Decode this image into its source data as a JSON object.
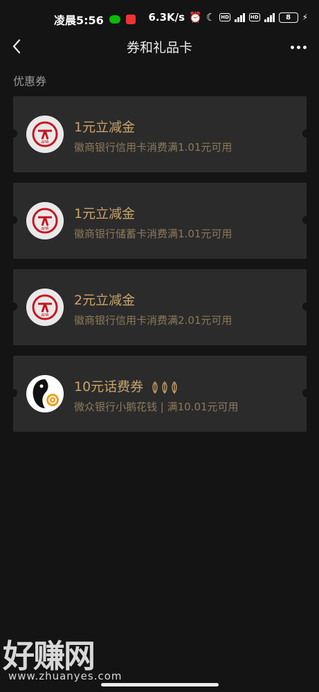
{
  "status_bar": {
    "time": "凌晨5:56",
    "speed": "6.3K/s",
    "hd1": "HD",
    "net1": "4G",
    "hd2": "HD",
    "net2": "5G",
    "battery": "8"
  },
  "nav": {
    "title": "券和礼品卡",
    "back_icon": "chevron-left-icon",
    "more_icon": "more-dots-icon"
  },
  "section_label": "优惠券",
  "coupons": [
    {
      "title": "1元立减金",
      "desc": "徽商银行信用卡消费满1.01元可用",
      "logo": "huishang-bank-logo"
    },
    {
      "title": "1元立减金",
      "desc": "徽商银行储蓄卡消费满1.01元可用",
      "logo": "huishang-bank-logo"
    },
    {
      "title": "2元立减金",
      "desc": "徽商银行信用卡消费满2.01元可用",
      "logo": "huishang-bank-logo"
    },
    {
      "title": "10元话费券",
      "desc": "微众银行小鹅花钱 | 满10.01元可用",
      "logo": "webank-penguin-logo"
    }
  ],
  "watermark": {
    "text": "好赚网",
    "url": "www.zhuanyes.com"
  },
  "colors": {
    "background": "#141414",
    "card": "#2b2b2b",
    "gold": "#c8a46a",
    "bank_red": "#c8141e"
  }
}
